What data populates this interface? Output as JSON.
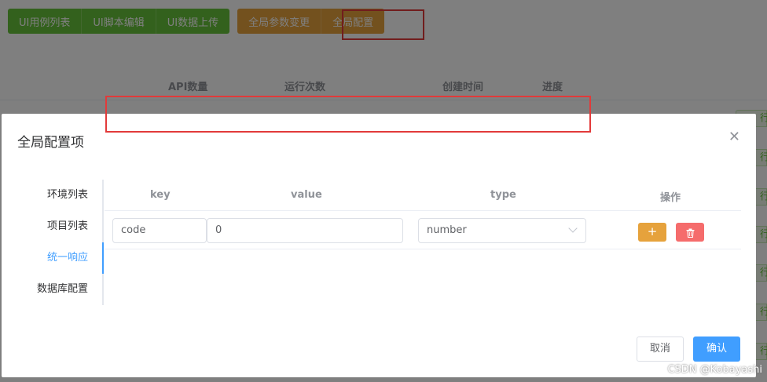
{
  "toolbar": {
    "ui_group": [
      "UI用例列表",
      "UI脚本编辑",
      "UI数据上传"
    ],
    "global_group": [
      "全局参数变更",
      "全局配置"
    ]
  },
  "bg_table": {
    "headers": [
      "API数量",
      "运行次数",
      "创建时间",
      "进度"
    ],
    "row_button_label": "行"
  },
  "dialog": {
    "title": "全局配置项",
    "close_icon": "close-icon",
    "side_tabs": [
      "环境列表",
      "项目列表",
      "统一响应",
      "数据库配置"
    ],
    "active_tab": "统一响应",
    "table": {
      "headers": {
        "key": "key",
        "value": "value",
        "type": "type",
        "ops": "操作"
      },
      "rows": [
        {
          "key": "code",
          "value": "0",
          "type": "number"
        }
      ]
    },
    "add_label": "+",
    "delete_icon": "trash-icon",
    "cancel_label": "取消",
    "ok_label": "确认"
  },
  "watermark": "CSDN @Kobayashi",
  "colors": {
    "primary": "#409eff",
    "success": "#67c23a",
    "warning": "#e6a23c",
    "danger": "#f56c6c",
    "highlight": "#e23a3a"
  }
}
